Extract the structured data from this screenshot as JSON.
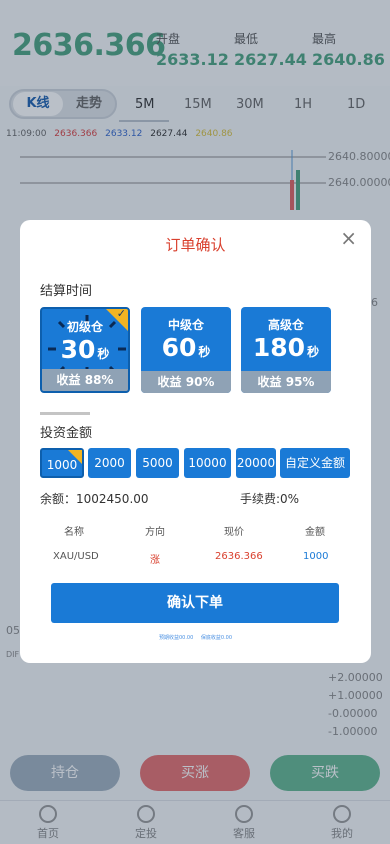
{
  "quote": {
    "price": "2636.366",
    "open_label": "开盘",
    "open_value": "2633.12",
    "low_label": "最低",
    "low_value": "2627.44",
    "high_label": "最高",
    "high_value": "2640.86"
  },
  "chart_toggle": {
    "kline": "K线",
    "trend": "走势"
  },
  "timeframes": [
    "5M",
    "15M",
    "30M",
    "1H",
    "1D"
  ],
  "legend": {
    "time": "11:09:00",
    "values": [
      "2636.366",
      "2633.12",
      "2627.44",
      "2640.86"
    ],
    "colors": [
      "#d94040",
      "#3366cc",
      "#333333",
      "#d8c040"
    ]
  },
  "chart_axis": {
    "top_labels": [
      "2640.80000",
      "2640.00000"
    ],
    "macd_labels": [
      "+2.00000",
      "+1.00000",
      "-0.00000",
      "-1.00000"
    ],
    "partial_label_6": "6",
    "partial_label_05": "05",
    "partial_label_dif": "DIF"
  },
  "actions": {
    "hold": "持仓",
    "buy_up": "买涨",
    "buy_down": "买跌"
  },
  "tabbar": {
    "home": "首页",
    "fixed": "定投",
    "service": "客服",
    "mine": "我的"
  },
  "modal": {
    "title": "订单确认",
    "settle_time_label": "结算时间",
    "cards": [
      {
        "name": "初级仓",
        "seconds": "30",
        "unit": "秒",
        "yield": "收益 88%"
      },
      {
        "name": "中级仓",
        "seconds": "60",
        "unit": "秒",
        "yield": "收益 90%"
      },
      {
        "name": "高级仓",
        "seconds": "180",
        "unit": "秒",
        "yield": "收益 95%"
      }
    ],
    "amount_label": "投资金额",
    "amounts": [
      "1000",
      "2000",
      "5000",
      "10000",
      "20000"
    ],
    "custom_amount": "自定义金额",
    "balance": "余额：1002450.00",
    "fee": "手续费:0%",
    "table_headers": [
      "名称",
      "方向",
      "现价",
      "金额"
    ],
    "row": {
      "name": "XAU/USD",
      "direction": "涨",
      "price": "2636.366",
      "amount": "1000"
    },
    "confirm_button": "确认下单",
    "footer_notes": [
      "预期收益00.00",
      "保底收益0.00"
    ]
  },
  "colors": {
    "accent": "#1a7ad6",
    "up_green": "#4ba37f",
    "title_red": "#d9412f",
    "badge_gold": "#f2b422"
  }
}
